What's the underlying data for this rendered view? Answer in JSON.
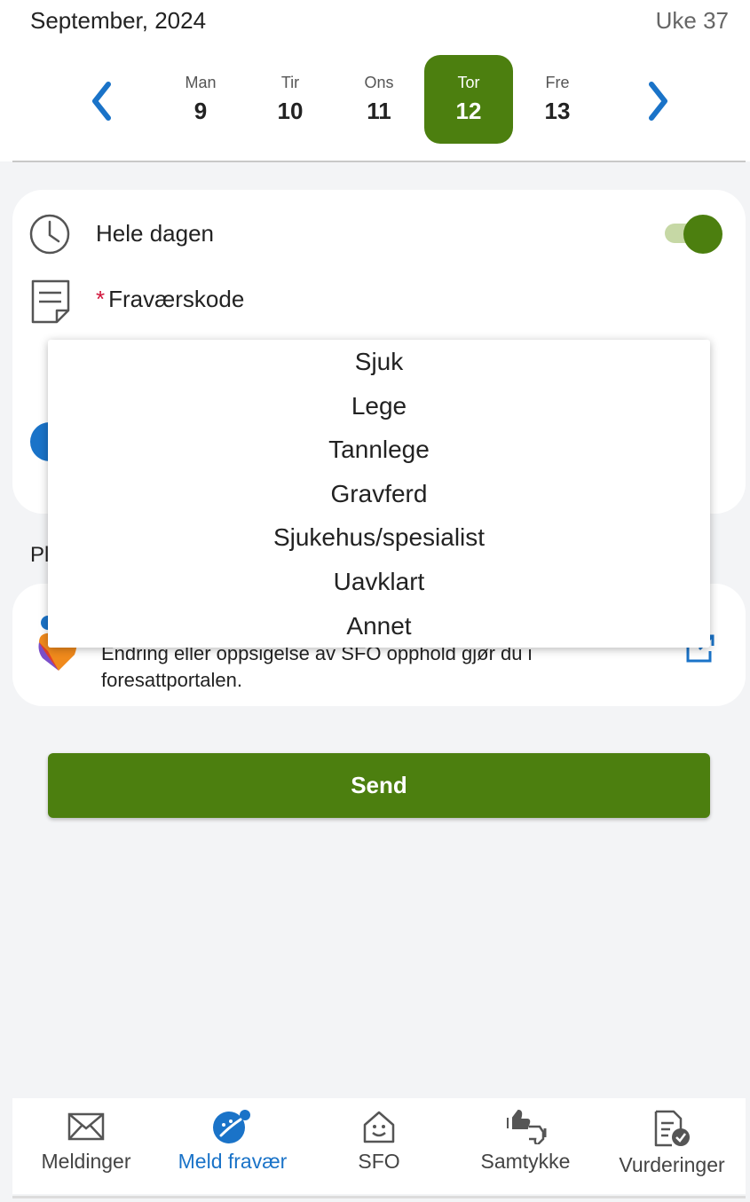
{
  "header": {
    "month": "September, 2024",
    "week": "Uke 37",
    "days": [
      {
        "name": "Man",
        "num": "9"
      },
      {
        "name": "Tir",
        "num": "10"
      },
      {
        "name": "Ons",
        "num": "11"
      },
      {
        "name": "Tor",
        "num": "12",
        "selected": true
      },
      {
        "name": "Fre",
        "num": "13"
      }
    ]
  },
  "form": {
    "whole_day_label": "Hele dagen",
    "whole_day_on": true,
    "absence_code_required": "*",
    "absence_code_label": "Fraværskode",
    "section_label_partial": "Pl"
  },
  "dropdown": {
    "options": [
      "Sjuk",
      "Lege",
      "Tannlege",
      "Gravferd",
      "Sjukehus/spesialist",
      "Uavklart",
      "Annet"
    ]
  },
  "sfo_card": {
    "text": "Endring eller oppsigelse av SFO opphold gjør du i foresattportalen."
  },
  "send_label": "Send",
  "bottom_nav": {
    "items": [
      {
        "label": "Meldinger",
        "icon": "envelope-icon"
      },
      {
        "label": "Meld fravær",
        "icon": "absence-icon",
        "active": true
      },
      {
        "label": "SFO",
        "icon": "house-icon"
      },
      {
        "label": "Samtykke",
        "icon": "thumbs-icon"
      },
      {
        "label": "Vurderinger",
        "icon": "document-check-icon"
      }
    ]
  },
  "colors": {
    "primary_green": "#4c7f0f",
    "accent_blue": "#1a73c8",
    "required_red": "#d1143a"
  }
}
